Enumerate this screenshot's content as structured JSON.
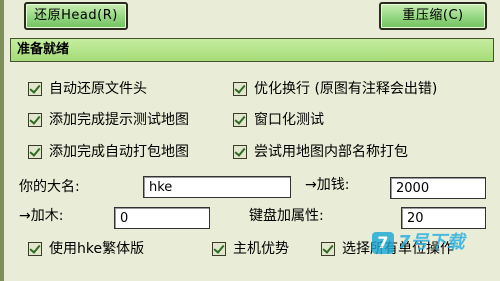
{
  "toolbar": {
    "restore_head_label": "还原Head(R)",
    "recompress_label": "重压缩(C)"
  },
  "status": {
    "text": "准备就绪"
  },
  "options": [
    {
      "label": "自动还原文件头",
      "checked": true
    },
    {
      "label": "优化换行 (原图有注释会出错)",
      "checked": true
    },
    {
      "label": "添加完成提示测试地图",
      "checked": true
    },
    {
      "label": "窗口化测试",
      "checked": true
    },
    {
      "label": "添加完成自动打包地图",
      "checked": true
    },
    {
      "label": "尝试用地图内部名称打包",
      "checked": true
    }
  ],
  "fields": {
    "name_label": "你的大名:",
    "name_value": "hke",
    "money_label": "→加钱:",
    "money_value": "2000",
    "wood_label": "→加木:",
    "wood_value": "0",
    "keyboard_label": "键盘加属性:",
    "keyboard_value": "20"
  },
  "bottom_options": [
    {
      "label": "使用hke繁体版",
      "checked": true
    },
    {
      "label": "主机优势",
      "checked": true
    },
    {
      "label": "选择所有单位操作",
      "checked": true
    }
  ],
  "watermark": {
    "badge": "7",
    "text": "7号下载"
  }
}
